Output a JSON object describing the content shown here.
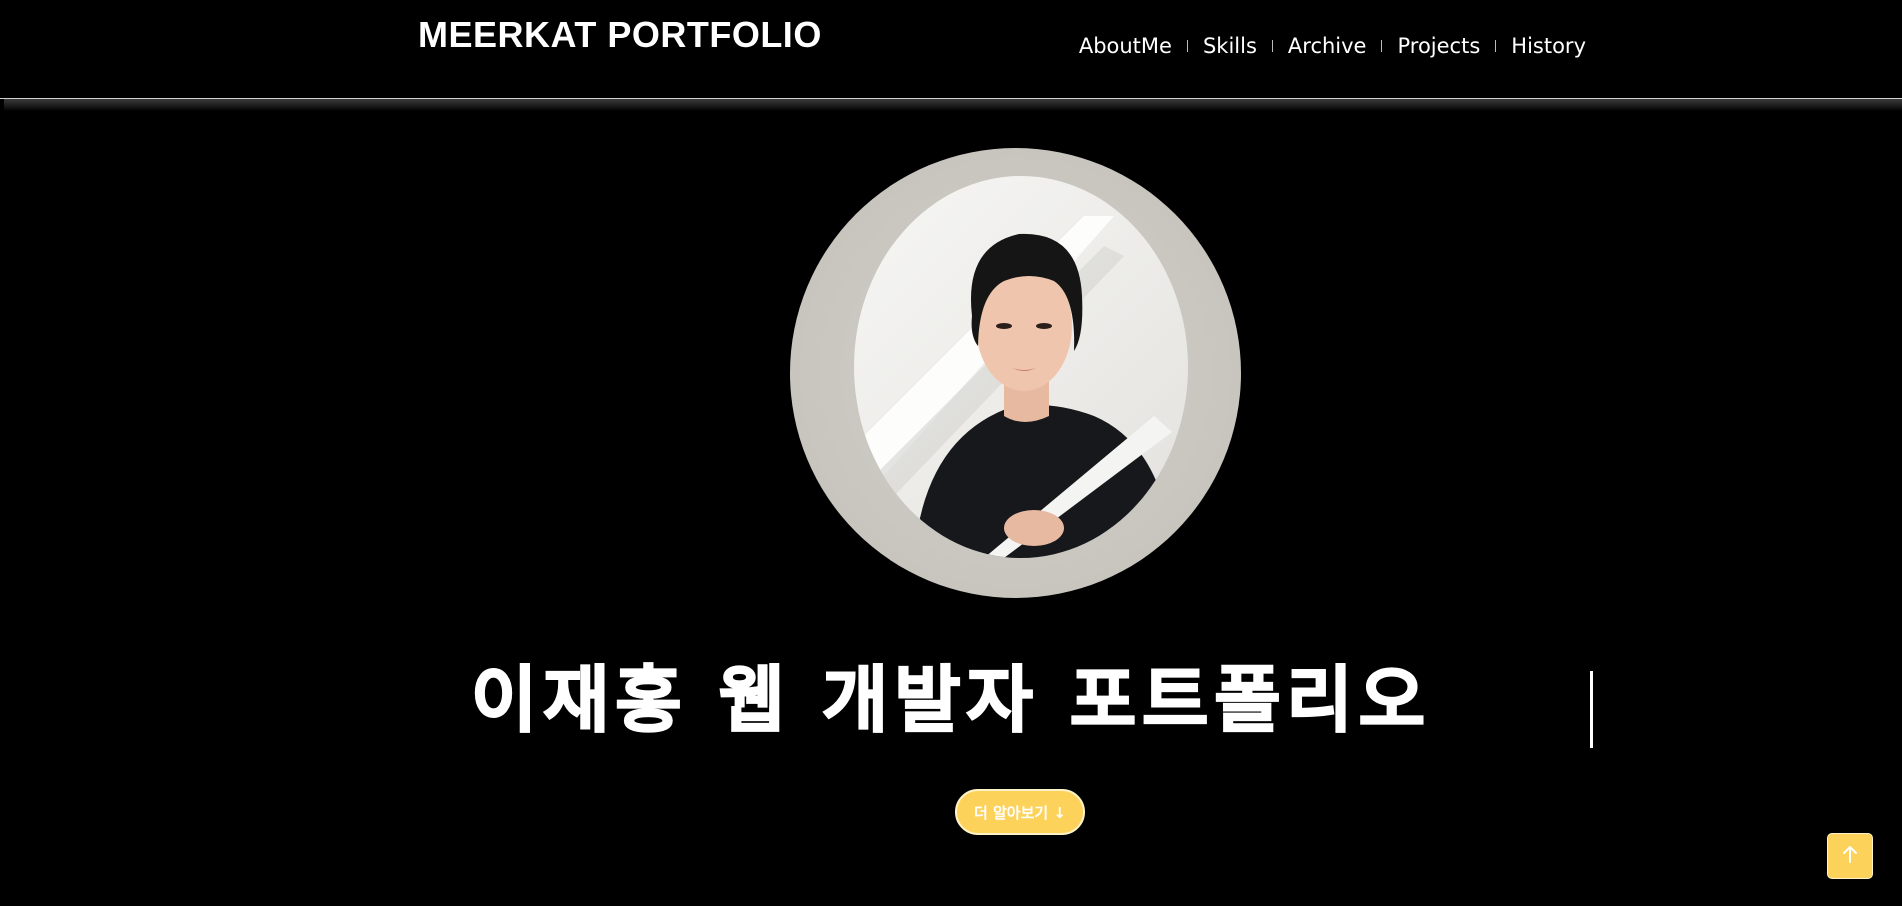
{
  "header": {
    "logo": "MEERKAT PORTFOLIO",
    "nav": [
      {
        "label": "AboutMe"
      },
      {
        "label": "Skills"
      },
      {
        "label": "Archive"
      },
      {
        "label": "Projects"
      },
      {
        "label": "History"
      }
    ]
  },
  "hero": {
    "title": "이재홍 웹 개발자 포트폴리오",
    "more_button_label": "더 알아보기 ↓"
  },
  "scroll_top": {
    "icon": "arrow-up-icon"
  },
  "colors": {
    "background": "#000000",
    "accent": "#fdd25a",
    "text": "#ffffff"
  }
}
